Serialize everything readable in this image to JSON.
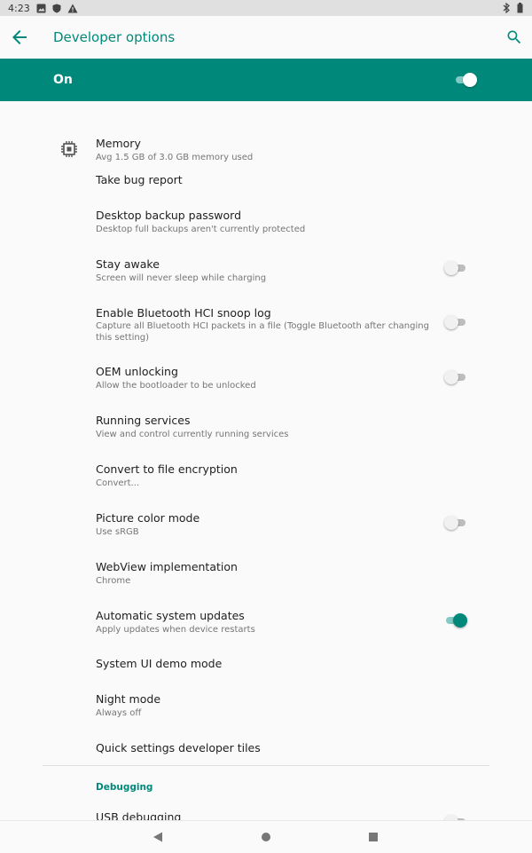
{
  "status_bar": {
    "time": "4:23"
  },
  "app_bar": {
    "title": "Developer options"
  },
  "master": {
    "label": "On",
    "enabled": true
  },
  "items": [
    {
      "title": "Memory",
      "subtitle": "Avg 1.5 GB of 3.0 GB memory used",
      "icon": "memory-chip-icon"
    },
    {
      "title": "Take bug report"
    },
    {
      "title": "Desktop backup password",
      "subtitle": "Desktop full backups aren't currently protected"
    },
    {
      "title": "Stay awake",
      "subtitle": "Screen will never sleep while charging",
      "switch": false
    },
    {
      "title": "Enable Bluetooth HCI snoop log",
      "subtitle": "Capture all Bluetooth HCI packets in a file (Toggle Bluetooth after changing this setting)",
      "switch": false
    },
    {
      "title": "OEM unlocking",
      "subtitle": "Allow the bootloader to be unlocked",
      "switch": false
    },
    {
      "title": "Running services",
      "subtitle": "View and control currently running services"
    },
    {
      "title": "Convert to file encryption",
      "subtitle": "Convert..."
    },
    {
      "title": "Picture color mode",
      "subtitle": "Use sRGB",
      "switch": false
    },
    {
      "title": "WebView implementation",
      "subtitle": "Chrome"
    },
    {
      "title": "Automatic system updates",
      "subtitle": "Apply updates when device restarts",
      "switch": true
    },
    {
      "title": "System UI demo mode"
    },
    {
      "title": "Night mode",
      "subtitle": "Always off"
    },
    {
      "title": "Quick settings developer tiles"
    }
  ],
  "debugging": {
    "header": "Debugging",
    "items": [
      {
        "title": "USB debugging",
        "switch": false
      }
    ]
  },
  "colors": {
    "accent": "#00897b",
    "accent_light": "#80cbc4"
  }
}
